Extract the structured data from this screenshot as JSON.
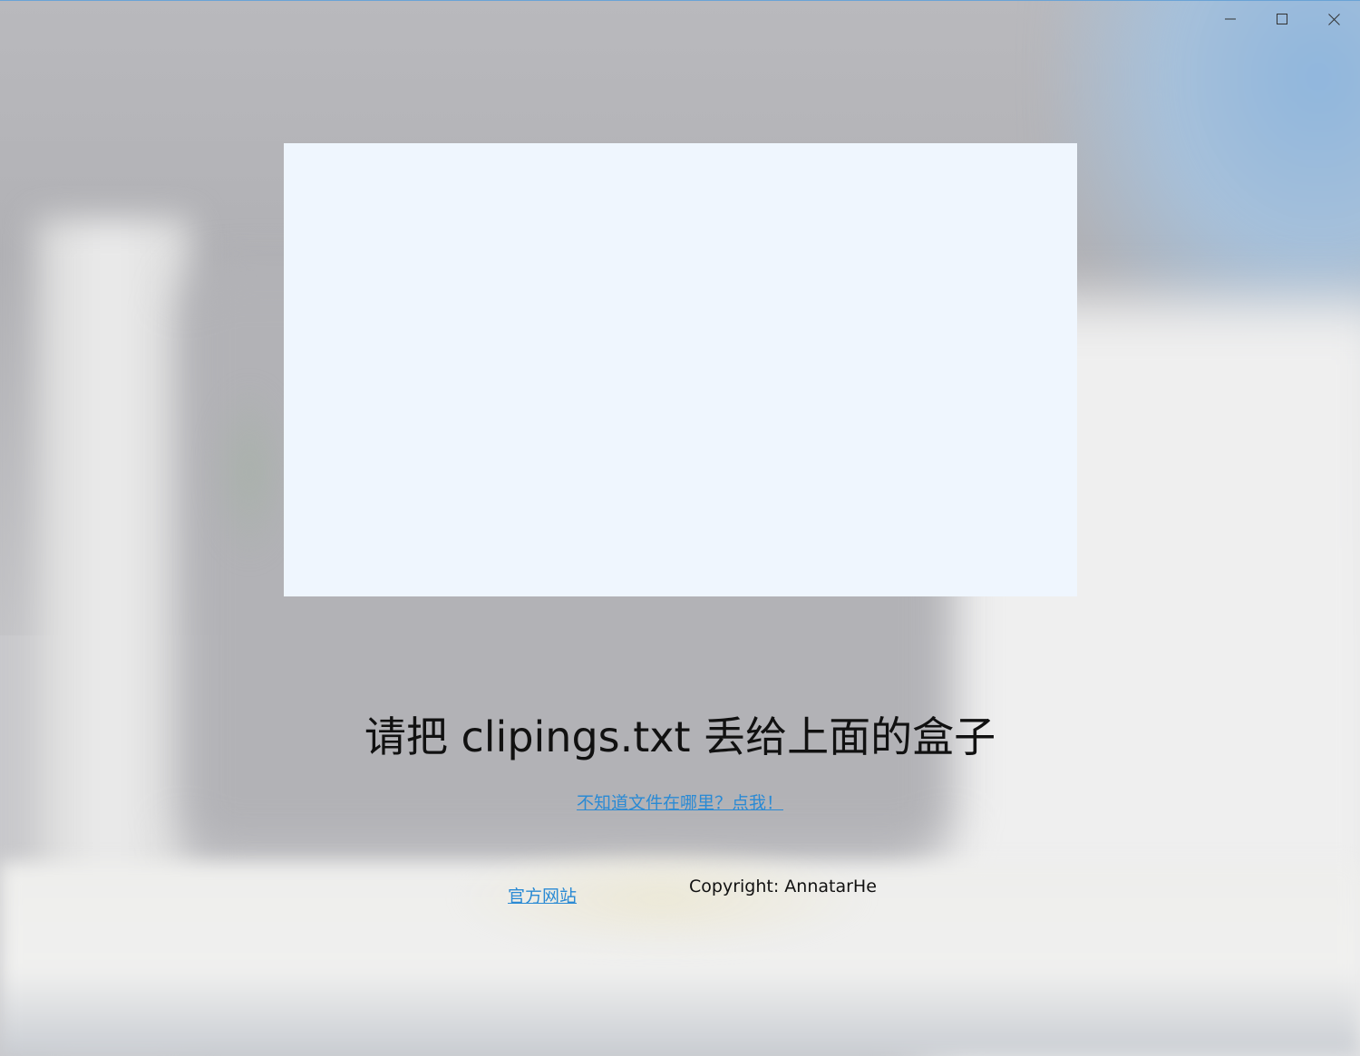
{
  "window": {
    "controls": {
      "minimize_icon": "minimize-icon",
      "maximize_icon": "maximize-icon",
      "close_icon": "close-icon"
    }
  },
  "main": {
    "instruction": "请把 clipings.txt 丢给上面的盒子",
    "help_link": "不知道文件在哪里？点我！",
    "site_link": "官方网站",
    "copyright": "Copyright: AnnatarHe"
  },
  "colors": {
    "drop_box": "#eff6fe",
    "link": "#2a8ad4",
    "text": "#111111"
  }
}
